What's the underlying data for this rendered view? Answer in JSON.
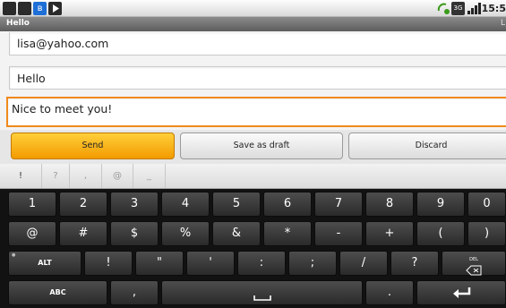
{
  "status_bar": {
    "left_icons": [
      "usb-debug-icon",
      "sd-card-icon",
      "bluetooth-icon",
      "play-icon"
    ],
    "right_icons": [
      "sync-icon",
      "3g-icon",
      "signal-icon"
    ],
    "time": "15:5"
  },
  "title_bar": {
    "title": "Hello",
    "right_text": "L"
  },
  "compose": {
    "to": "lisa@yahoo.com",
    "subject": "Hello",
    "body": "Nice to meet you!"
  },
  "buttons": {
    "send": "Send",
    "save_draft": "Save as draft",
    "discard": "Discard"
  },
  "suggestions": [
    "!",
    "?",
    ",",
    "@",
    "_"
  ],
  "keyboard": {
    "row1": [
      "1",
      "2",
      "3",
      "4",
      "5",
      "6",
      "7",
      "8",
      "9",
      "0"
    ],
    "row2": [
      "@",
      "#",
      "$",
      "%",
      "&",
      "*",
      "-",
      "+",
      "(",
      ")"
    ],
    "row3": {
      "alt": "ALT",
      "keys": [
        "!",
        "\"",
        "'",
        ":",
        ";",
        "/",
        "?"
      ],
      "del": "DEL"
    },
    "row4": {
      "abc": "ABC",
      "comma": ",",
      "period": "."
    },
    "colors": {
      "accent": "#f39b00",
      "key_bg": "#3a3a3a",
      "key_text": "#ffffff"
    }
  }
}
